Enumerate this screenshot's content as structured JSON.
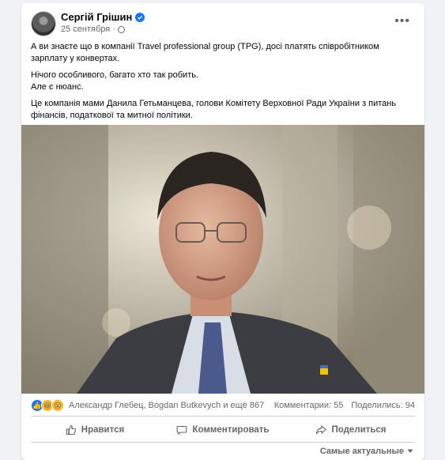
{
  "post": {
    "author": "Сергій Грішин",
    "date": "25 сентября",
    "paragraphs": [
      "А ви знаєте що в компанії Travel professional group (TPG), досі платять співробітником зарплату у конвертах.",
      "Нічого особливого, багато хто так робить.\nАле є нюанс.",
      "Це компанія мами Данила Гетьманцева, голови Комітету Верховної Ради України з питань фінансів, податкової та митної політики."
    ]
  },
  "reactions": {
    "names": "Александр Глебец, Bogdan Butkevych и ещё 867",
    "comments": "Комментарии: 55",
    "shares": "Поделились: 94",
    "icons": [
      "like-icon",
      "haha-icon",
      "wow-icon"
    ],
    "colors": {
      "like": "#1877f2",
      "emoji": "#f7b928"
    }
  },
  "actions": {
    "like": "Нравится",
    "comment": "Комментировать",
    "share": "Поделиться"
  },
  "sort": {
    "label": "Самые актуальные"
  }
}
